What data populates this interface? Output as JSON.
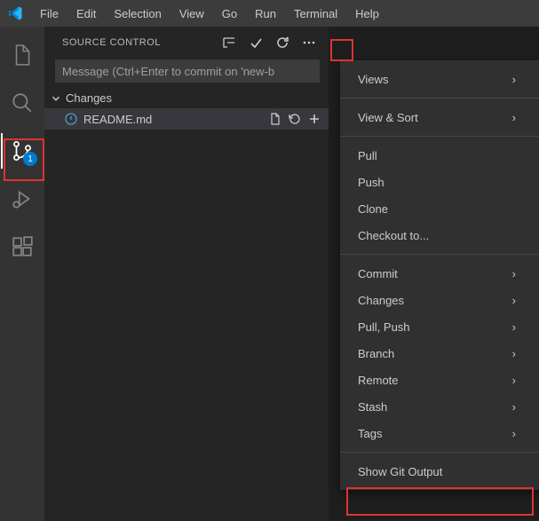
{
  "menu": {
    "file": "File",
    "edit": "Edit",
    "selection": "Selection",
    "view": "View",
    "go": "Go",
    "run": "Run",
    "terminal": "Terminal",
    "help": "Help"
  },
  "activity": {
    "scm_badge": "1"
  },
  "panel": {
    "title": "SOURCE CONTROL",
    "message_placeholder": "Message (Ctrl+Enter to commit on 'new-b",
    "changes_label": "Changes",
    "file": {
      "name": "README.md"
    }
  },
  "ctx": {
    "views": "Views",
    "view_sort": "View & Sort",
    "pull": "Pull",
    "push": "Push",
    "clone": "Clone",
    "checkout": "Checkout to...",
    "commit": "Commit",
    "changes": "Changes",
    "pull_push": "Pull, Push",
    "branch": "Branch",
    "remote": "Remote",
    "stash": "Stash",
    "tags": "Tags",
    "show_git": "Show Git Output"
  }
}
